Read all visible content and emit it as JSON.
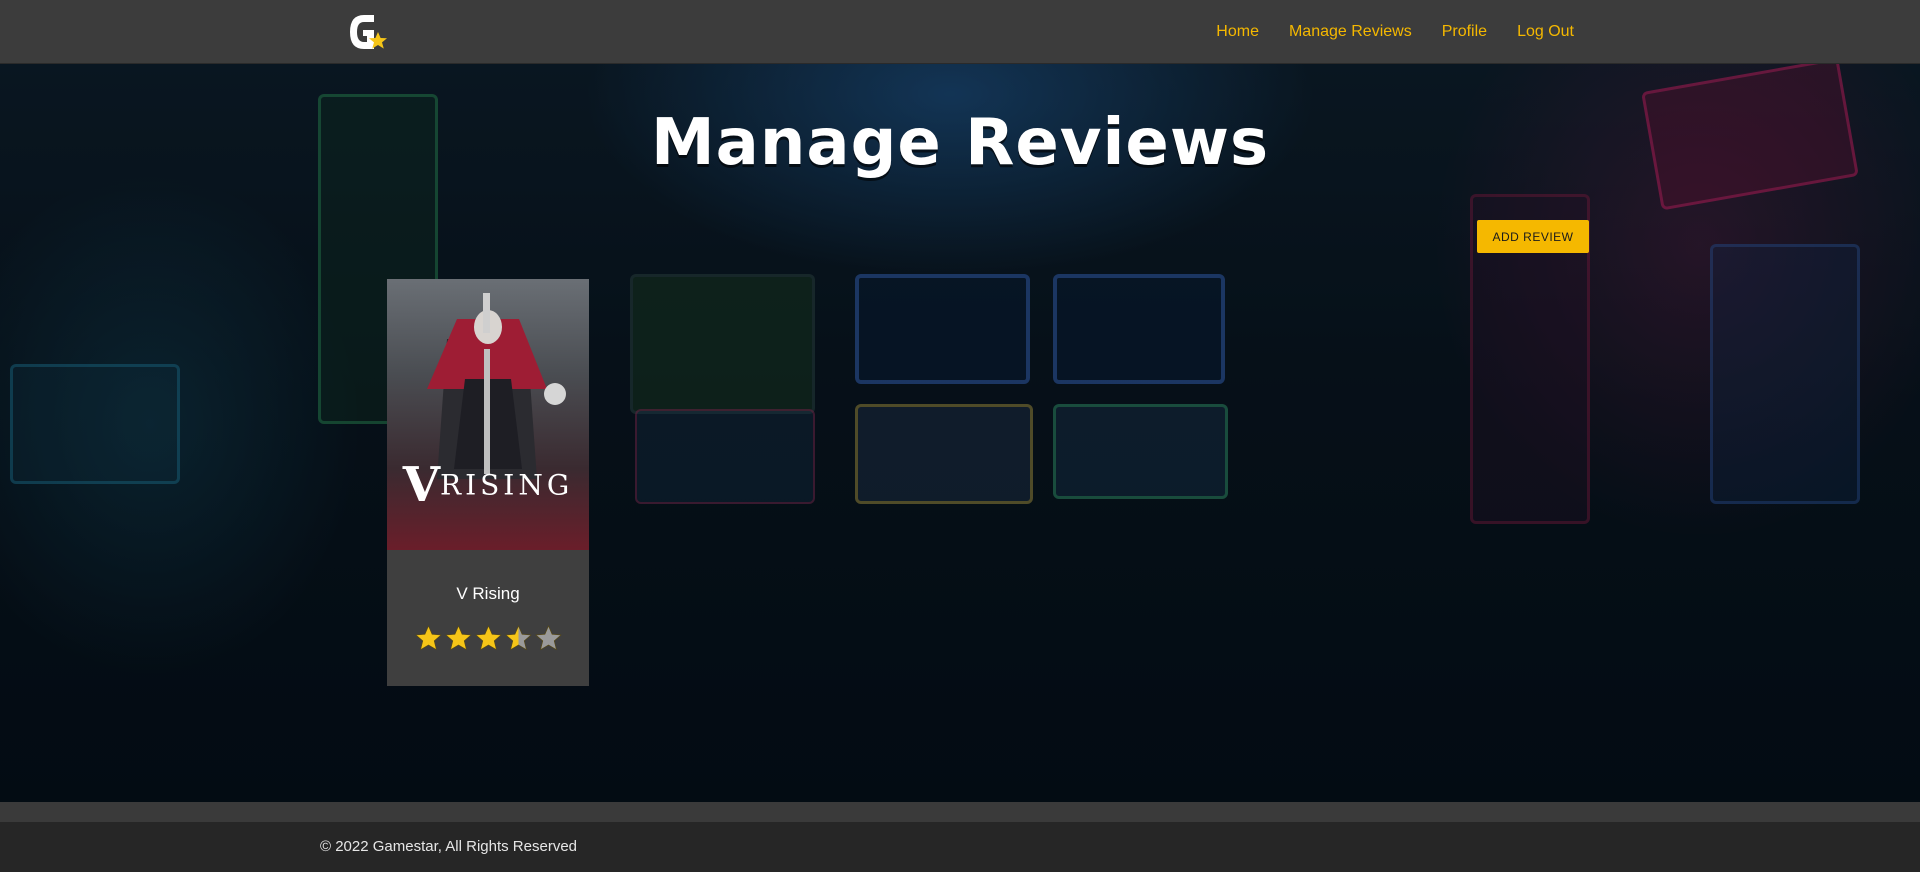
{
  "nav": {
    "logo_icon": "gamestar-logo-icon",
    "links": [
      "Home",
      "Manage Reviews",
      "Profile",
      "Log Out"
    ],
    "link_color": "#f5b800"
  },
  "hero": {
    "title": "Manage Reviews",
    "add_button_label": "ADD REVIEW"
  },
  "reviews": [
    {
      "title": "V Rising",
      "cover_logo_v": "V",
      "cover_logo_rest": "RISING",
      "rating": 3.5,
      "max_rating": 5
    }
  ],
  "colors": {
    "accent": "#f5b800",
    "star_filled": "#f5c518",
    "star_empty": "#9a9a9a"
  },
  "footer": {
    "copyright": "© 2022 Gamestar, All Rights Reserved"
  }
}
